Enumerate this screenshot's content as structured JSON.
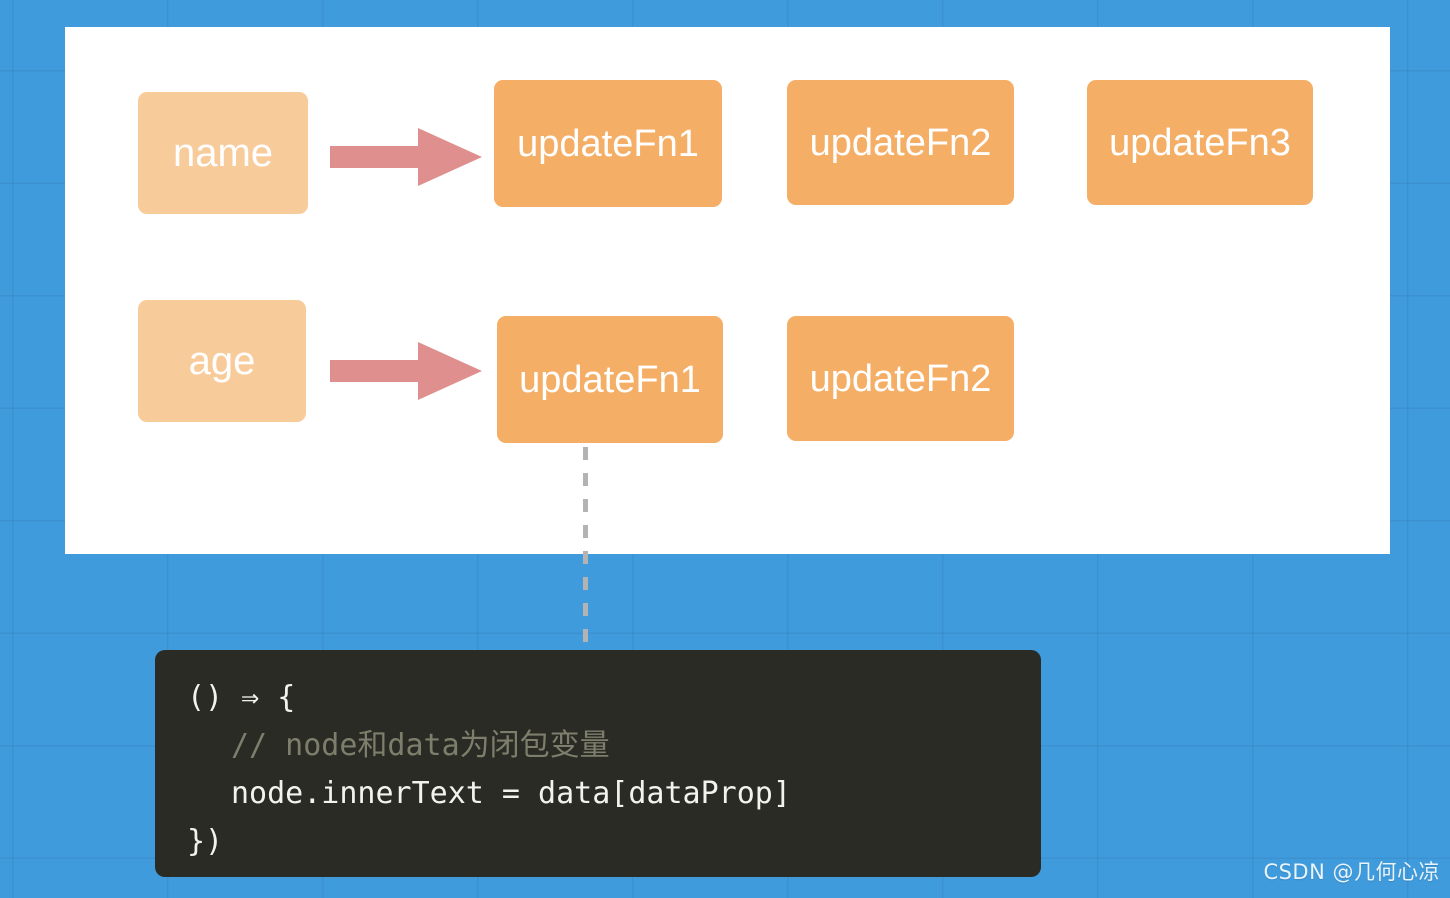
{
  "canvas": {
    "background_color": "#3f9bdc",
    "panel_color": "#ffffff",
    "grid_line_color": "rgba(0,0,0,0.055)"
  },
  "palette": {
    "key_box": "#f8cb9a",
    "fn_box": "#f5ae65",
    "arrow": "#e08f8f",
    "dashed_line": "#b3b3b3",
    "code_background": "#2a2b24",
    "code_text": "#f2f2ef",
    "code_comment": "#7e7e6c"
  },
  "diagram": {
    "rows": [
      {
        "key_label": "name",
        "functions": [
          "updateFn1",
          "updateFn2",
          "updateFn3"
        ]
      },
      {
        "key_label": "age",
        "functions": [
          "updateFn1",
          "updateFn2"
        ]
      }
    ]
  },
  "code": {
    "lines": [
      "() ⇒ {",
      "// node和data为闭包变量",
      "node.innerText = data[dataProp]",
      "})"
    ]
  },
  "watermark": {
    "text": "CSDN @几何心凉"
  }
}
